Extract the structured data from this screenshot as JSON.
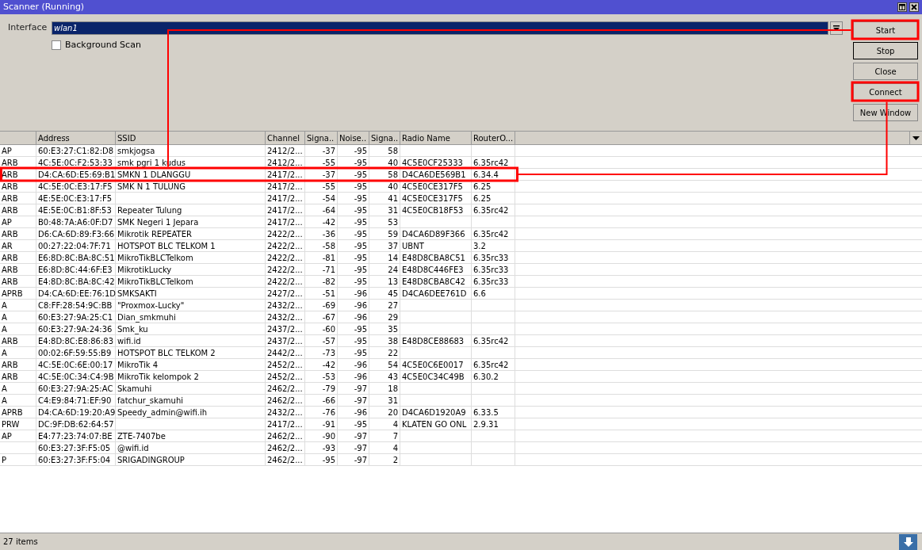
{
  "window": {
    "title": "Scanner (Running)"
  },
  "interface": {
    "label": "Interface",
    "value": "wlan1"
  },
  "background_scan": {
    "label": "Background Scan",
    "checked": false
  },
  "buttons": [
    {
      "label": "Start",
      "focused": false,
      "annotated": true
    },
    {
      "label": "Stop",
      "focused": true,
      "annotated": false
    },
    {
      "label": "Close",
      "focused": false,
      "annotated": false
    },
    {
      "label": "Connect",
      "focused": false,
      "annotated": true
    },
    {
      "label": "New Window",
      "focused": false,
      "annotated": false
    }
  ],
  "table": {
    "columns": [
      "Address",
      "SSID",
      "Channel",
      "Signa..",
      "Noise..",
      "Signa..",
      "Radio Name",
      "RouterO..."
    ],
    "rows": [
      {
        "flags": "AP",
        "address": "60:E3:27:C1:82:D8",
        "ssid": "smkjogsa",
        "channel": "2412/2...",
        "signal": "-37",
        "noise": "-95",
        "snr": "58",
        "annotated": false
      },
      {
        "flags": "ARB",
        "address": "4C:5E:0C:F2:53:33",
        "ssid": "smk pgri 1 kudus",
        "channel": "2412/2...",
        "signal": "-55",
        "noise": "-95",
        "snr": "40",
        "radio_name": "4C5E0CF25333",
        "router_os": "6.35rc42",
        "annotated": false
      },
      {
        "flags": "ARB",
        "address": "D4:CA:6D:E5:69:B1",
        "ssid": "SMKN 1 DLANGGU",
        "channel": "2417/2...",
        "signal": "-37",
        "noise": "-95",
        "snr": "58",
        "radio_name": "D4CA6DE569B1",
        "router_os": "6.34.4",
        "annotated": true
      },
      {
        "flags": "ARB",
        "address": "4C:5E:0C:E3:17:F5",
        "ssid": "SMK N 1 TULUNG",
        "channel": "2417/2...",
        "signal": "-55",
        "noise": "-95",
        "snr": "40",
        "radio_name": "4C5E0CE317F5",
        "router_os": "6.25",
        "annotated": false
      },
      {
        "flags": "ARB",
        "address": "4E:5E:0C:E3:17:F5",
        "channel": "2417/2...",
        "signal": "-54",
        "noise": "-95",
        "snr": "41",
        "radio_name": "4C5E0CE317F5",
        "router_os": "6.25",
        "annotated": false
      },
      {
        "flags": "ARB",
        "address": "4E:5E:0C:B1:8F:53",
        "ssid": "Repeater Tulung",
        "channel": "2417/2...",
        "signal": "-64",
        "noise": "-95",
        "snr": "31",
        "radio_name": "4C5E0CB18F53",
        "router_os": "6.35rc42",
        "annotated": false
      },
      {
        "flags": "AP",
        "address": "B0:48:7A:A6:0F:D7",
        "ssid": "SMK Negeri 1 Jepara",
        "channel": "2417/2...",
        "signal": "-42",
        "noise": "-95",
        "snr": "53",
        "annotated": false
      },
      {
        "flags": "ARB",
        "address": "D6:CA:6D:89:F3:66",
        "ssid": "Mikrotik REPEATER",
        "channel": "2422/2...",
        "signal": "-36",
        "noise": "-95",
        "snr": "59",
        "radio_name": "D4CA6D89F366",
        "router_os": "6.35rc42",
        "annotated": false
      },
      {
        "flags": "AR",
        "address": "00:27:22:04:7F:71",
        "ssid": "HOTSPOT BLC TELKOM 1",
        "channel": "2422/2...",
        "signal": "-58",
        "noise": "-95",
        "snr": "37",
        "radio_name": "UBNT",
        "router_os": "3.2",
        "annotated": false
      },
      {
        "flags": "ARB",
        "address": "E6:8D:8C:BA:8C:51",
        "ssid": "MikroTikBLCTelkom",
        "channel": "2422/2...",
        "signal": "-81",
        "noise": "-95",
        "snr": "14",
        "radio_name": "E48D8CBA8C51",
        "router_os": "6.35rc33",
        "annotated": false
      },
      {
        "flags": "ARB",
        "address": "E6:8D:8C:44:6F:E3",
        "ssid": "MikrotikLucky",
        "channel": "2422/2...",
        "signal": "-71",
        "noise": "-95",
        "snr": "24",
        "radio_name": "E48D8C446FE3",
        "router_os": "6.35rc33",
        "annotated": false
      },
      {
        "flags": "ARB",
        "address": "E4:8D:8C:BA:8C:42",
        "ssid": "MikroTikBLCTelkom",
        "channel": "2422/2...",
        "signal": "-82",
        "noise": "-95",
        "snr": "13",
        "radio_name": "E48D8CBA8C42",
        "router_os": "6.35rc33",
        "annotated": false
      },
      {
        "flags": "APRB",
        "address": "D4:CA:6D:EE:76:1D",
        "ssid": "SMKSAKTI",
        "channel": "2427/2...",
        "signal": "-51",
        "noise": "-96",
        "snr": "45",
        "radio_name": "D4CA6DEE761D",
        "router_os": "6.6",
        "annotated": false
      },
      {
        "flags": "A",
        "address": "C8:FF:28:54:9C:BB",
        "ssid": "\"Proxmox-Lucky\"",
        "channel": "2432/2...",
        "signal": "-69",
        "noise": "-96",
        "snr": "27",
        "annotated": false
      },
      {
        "flags": "A",
        "address": "60:E3:27:9A:25:C1",
        "ssid": "Dian_smkmuhi",
        "channel": "2432/2...",
        "signal": "-67",
        "noise": "-96",
        "snr": "29",
        "annotated": false
      },
      {
        "flags": "A",
        "address": "60:E3:27:9A:24:36",
        "ssid": "Smk_ku",
        "channel": "2437/2...",
        "signal": "-60",
        "noise": "-95",
        "snr": "35",
        "annotated": false
      },
      {
        "flags": "ARB",
        "address": "E4:8D:8C:E8:86:83",
        "ssid": "wifi.id",
        "channel": "2437/2...",
        "signal": "-57",
        "noise": "-95",
        "snr": "38",
        "radio_name": "E48D8CE88683",
        "router_os": "6.35rc42",
        "annotated": false
      },
      {
        "flags": "A",
        "address": "00:02:6F:59:55:B9",
        "ssid": "HOTSPOT BLC TELKOM 2",
        "channel": "2442/2...",
        "signal": "-73",
        "noise": "-95",
        "snr": "22",
        "annotated": false
      },
      {
        "flags": "ARB",
        "address": "4C:5E:0C:6E:00:17",
        "ssid": "MikroTik 4",
        "channel": "2452/2...",
        "signal": "-42",
        "noise": "-96",
        "snr": "54",
        "radio_name": "4C5E0C6E0017",
        "router_os": "6.35rc42",
        "annotated": false
      },
      {
        "flags": "ARB",
        "address": "4C:5E:0C:34:C4:9B",
        "ssid": "MikroTik kelompok 2",
        "channel": "2452/2...",
        "signal": "-53",
        "noise": "-96",
        "snr": "43",
        "radio_name": "4C5E0C34C49B",
        "router_os": "6.30.2",
        "annotated": false
      },
      {
        "flags": "A",
        "address": "60:E3:27:9A:25:AC",
        "ssid": "Skamuhi",
        "channel": "2462/2...",
        "signal": "-79",
        "noise": "-97",
        "snr": "18",
        "annotated": false
      },
      {
        "flags": "A",
        "address": "C4:E9:84:71:EF:90",
        "ssid": "fatchur_skamuhi",
        "channel": "2462/2...",
        "signal": "-66",
        "noise": "-97",
        "snr": "31",
        "annotated": false
      },
      {
        "flags": "APRB",
        "address": "D4:CA:6D:19:20:A9",
        "ssid": "Speedy_admin@wifi.ih",
        "channel": "2432/2...",
        "signal": "-76",
        "noise": "-96",
        "snr": "20",
        "radio_name": "D4CA6D1920A9",
        "router_os": "6.33.5",
        "annotated": false
      },
      {
        "flags": "PRW",
        "address": "DC:9F:DB:62:64:57",
        "channel": "2417/2...",
        "signal": "-91",
        "noise": "-95",
        "snr": "4",
        "radio_name": "KLATEN GO ONL",
        "router_os": "2.9.31",
        "annotated": false
      },
      {
        "flags": "AP",
        "address": "E4:77:23:74:07:BE",
        "ssid": "ZTE-7407be",
        "channel": "2462/2...",
        "signal": "-90",
        "noise": "-97",
        "snr": "7",
        "annotated": false
      },
      {
        "address": "60:E3:27:3F:F5:05",
        "ssid": "@wifi.id",
        "channel": "2462/2...",
        "signal": "-93",
        "noise": "-97",
        "snr": "4",
        "annotated": false
      },
      {
        "flags": "P",
        "address": "60:E3:27:3F:F5:04",
        "ssid": "SRIGADINGROUP",
        "channel": "2462/2...",
        "signal": "-95",
        "noise": "-97",
        "snr": "2",
        "annotated": false
      }
    ]
  },
  "status_bar": {
    "text": "27 items"
  }
}
